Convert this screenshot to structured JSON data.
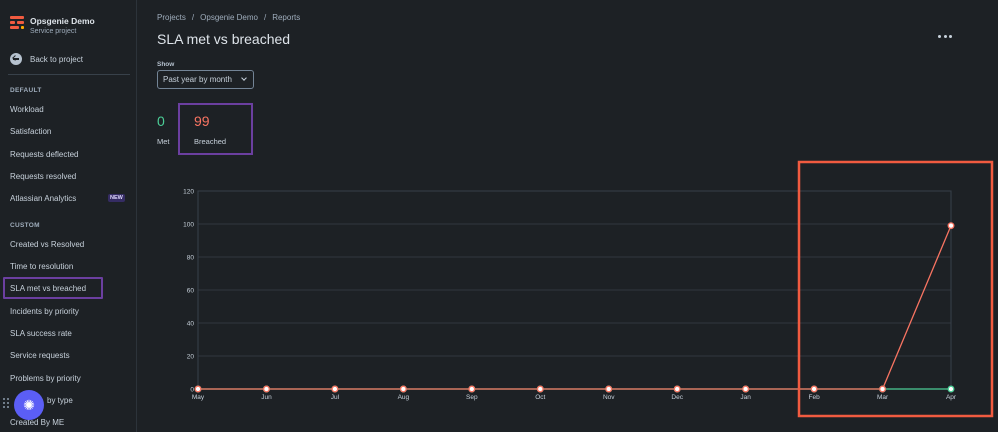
{
  "sidebar": {
    "project_name": "Opsgenie Demo",
    "project_type": "Service project",
    "back_label": "Back to project",
    "sections": [
      {
        "title": "DEFAULT",
        "items": [
          "Workload",
          "Satisfaction",
          "Requests deflected",
          "Requests resolved",
          "Atlassian Analytics"
        ]
      },
      {
        "title": "CUSTOM",
        "items": [
          "Created vs Resolved",
          "Time to resolution",
          "SLA met vs breached",
          "Incidents by priority",
          "SLA success rate",
          "Service requests",
          "Problems by priority",
          "by type",
          "Created By ME"
        ]
      }
    ],
    "badge": "NEW",
    "selected_item": "SLA met vs breached",
    "brand_colors": [
      "#f15b40",
      "#ffab00"
    ]
  },
  "breadcrumb": [
    "Projects",
    "Opsgenie Demo",
    "Reports"
  ],
  "page_title": "SLA met vs breached",
  "filter": {
    "label": "Show",
    "value": "Past year by month"
  },
  "stats": {
    "met": {
      "value": "0",
      "label": "Met",
      "color": "#4bce97"
    },
    "breached": {
      "value": "99",
      "label": "Breached",
      "color": "#f87462"
    }
  },
  "chart_data": {
    "type": "line",
    "categories": [
      "May",
      "Jun",
      "Jul",
      "Aug",
      "Sep",
      "Oct",
      "Nov",
      "Dec",
      "Jan",
      "Feb",
      "Mar",
      "Apr"
    ],
    "series": [
      {
        "name": "Met",
        "color": "#4bce97",
        "values": [
          0,
          0,
          0,
          0,
          0,
          0,
          0,
          0,
          0,
          0,
          0,
          0
        ]
      },
      {
        "name": "Breached",
        "color": "#f87462",
        "values": [
          0,
          0,
          0,
          0,
          0,
          0,
          0,
          0,
          0,
          0,
          0,
          99
        ]
      }
    ],
    "yticks": [
      0,
      20,
      40,
      60,
      80,
      100,
      120
    ],
    "ylim": [
      0,
      120
    ],
    "grid": true
  },
  "annotations": {
    "highlight_color": "#f15b40",
    "outline_color": "#6b3fa0"
  }
}
